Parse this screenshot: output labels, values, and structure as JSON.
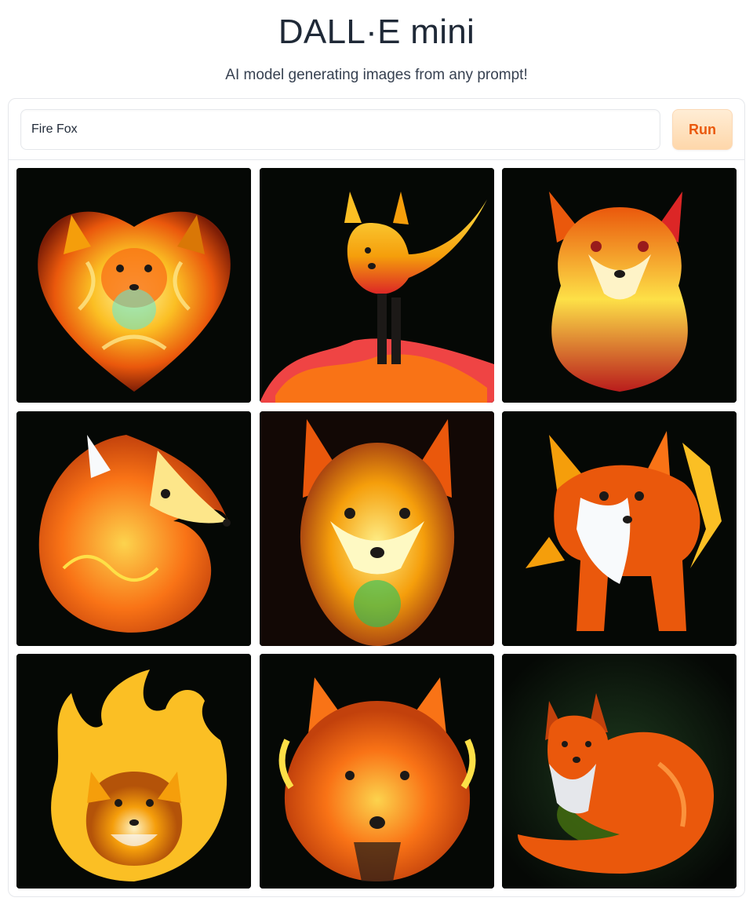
{
  "app": {
    "title": "DALL·E mini",
    "subtitle": "AI model generating images from any prompt!"
  },
  "prompt": {
    "value": "Fire Fox"
  },
  "run_button": {
    "label": "Run",
    "accent": "#ea580c"
  },
  "gallery": {
    "images": [
      {
        "subject": "fire-fox-heart-swirl"
      },
      {
        "subject": "fire-fox-standing-flames"
      },
      {
        "subject": "fire-fox-sitting-front"
      },
      {
        "subject": "fire-fox-side-profile"
      },
      {
        "subject": "fire-fox-face-glowing"
      },
      {
        "subject": "fire-fox-white-chest"
      },
      {
        "subject": "fire-fox-flame-circle"
      },
      {
        "subject": "fire-fox-face-flames"
      },
      {
        "subject": "fire-fox-curled-realistic"
      }
    ]
  },
  "colors": {
    "background": "#ffffff",
    "panel_border": "#e5e7eb",
    "image_background": "#050805",
    "fire_orange": "#f97316",
    "fire_yellow": "#fde047"
  }
}
